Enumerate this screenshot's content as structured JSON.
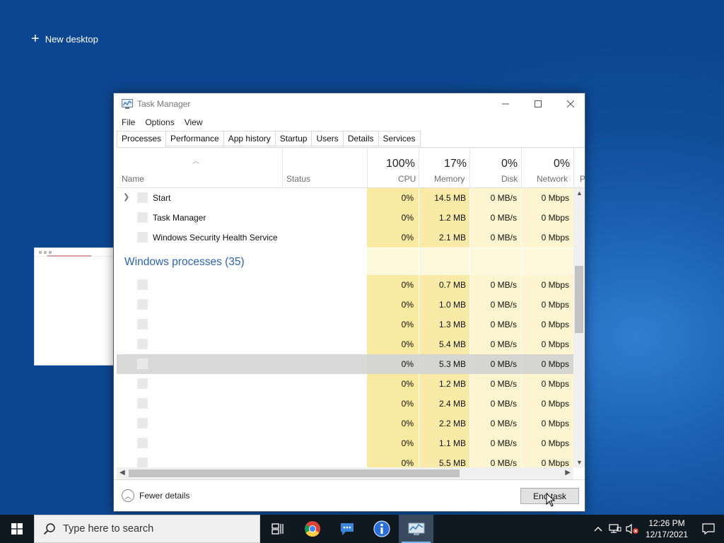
{
  "desktop": {
    "new_desktop_label": "New desktop"
  },
  "window": {
    "title": "Task Manager",
    "menu": [
      "File",
      "Options",
      "View"
    ],
    "tabs": [
      "Processes",
      "Performance",
      "App history",
      "Startup",
      "Users",
      "Details",
      "Services"
    ],
    "active_tab": "Processes"
  },
  "columns": {
    "name": "Name",
    "status": "Status",
    "cpu": {
      "label": "CPU",
      "percent": "100%"
    },
    "memory": {
      "label": "Memory",
      "percent": "17%"
    },
    "disk": {
      "label": "Disk",
      "percent": "0%"
    },
    "network": {
      "label": "Network",
      "percent": "0%"
    },
    "power_truncated": "P"
  },
  "apps": [
    {
      "name": "Start",
      "cpu": "0%",
      "memory": "14.5 MB",
      "disk": "0 MB/s",
      "network": "0 Mbps",
      "expandable": true
    },
    {
      "name": "Task Manager",
      "cpu": "0%",
      "memory": "1.2 MB",
      "disk": "0 MB/s",
      "network": "0 Mbps",
      "expandable": false
    },
    {
      "name": "Windows Security Health Service",
      "cpu": "0%",
      "memory": "2.1 MB",
      "disk": "0 MB/s",
      "network": "0 Mbps",
      "expandable": false
    }
  ],
  "windows_processes": {
    "title": "Windows processes (35)",
    "rows": [
      {
        "cpu": "0%",
        "memory": "0.7 MB",
        "disk": "0 MB/s",
        "network": "0 Mbps"
      },
      {
        "cpu": "0%",
        "memory": "1.0 MB",
        "disk": "0 MB/s",
        "network": "0 Mbps"
      },
      {
        "cpu": "0%",
        "memory": "1.3 MB",
        "disk": "0 MB/s",
        "network": "0 Mbps"
      },
      {
        "cpu": "0%",
        "memory": "5.4 MB",
        "disk": "0 MB/s",
        "network": "0 Mbps"
      },
      {
        "cpu": "0%",
        "memory": "5.3 MB",
        "disk": "0 MB/s",
        "network": "0 Mbps",
        "selected": true
      },
      {
        "cpu": "0%",
        "memory": "1.2 MB",
        "disk": "0 MB/s",
        "network": "0 Mbps"
      },
      {
        "cpu": "0%",
        "memory": "2.4 MB",
        "disk": "0 MB/s",
        "network": "0 Mbps"
      },
      {
        "cpu": "0%",
        "memory": "2.2 MB",
        "disk": "0 MB/s",
        "network": "0 Mbps"
      },
      {
        "cpu": "0%",
        "memory": "1.1 MB",
        "disk": "0 MB/s",
        "network": "0 Mbps"
      },
      {
        "cpu": "0%",
        "memory": "5.5 MB",
        "disk": "0 MB/s",
        "network": "0 Mbps"
      }
    ]
  },
  "footer": {
    "fewer_details": "Fewer details",
    "end_task": "End task"
  },
  "taskbar": {
    "search_placeholder": "Type here to search",
    "apps": [
      "task-view-icon",
      "chrome-icon",
      "chat-icon",
      "info-icon",
      "task-manager-icon"
    ],
    "time": "12:26 PM",
    "date": "12/17/2021"
  }
}
